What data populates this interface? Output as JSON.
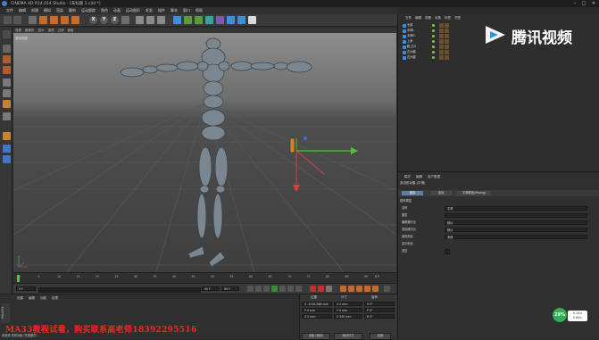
{
  "window": {
    "title": "CINEMA 4D R14.014 Studio - [未标题 1.c4d *]",
    "buttons": [
      "–",
      "□",
      "✕"
    ]
  },
  "menubar": {
    "items": [
      "文件",
      "编辑",
      "创建",
      "模拟",
      "渲染",
      "雕刻",
      "运动跟踪",
      "角色",
      "动画",
      "运动图形",
      "毛发",
      "插件",
      "脚本",
      "窗口",
      "帮助"
    ]
  },
  "toolbar": {
    "axis_x": "X",
    "axis_y": "Y",
    "axis_z": "Z"
  },
  "viewport": {
    "menu": [
      "查看",
      "摄像机",
      "显示",
      "选项",
      "过滤",
      "面板"
    ],
    "label": "透视视图"
  },
  "timeline": {
    "ticks": [
      "0",
      "5",
      "10",
      "15",
      "20",
      "25",
      "30",
      "35",
      "40",
      "45",
      "50",
      "55",
      "60",
      "65",
      "70",
      "75",
      "80",
      "85",
      "90"
    ],
    "current_frame": "0 F",
    "start_frame": "0 F",
    "end_frame": "90 F",
    "end_field": "90 F",
    "frame_readout": "0 F"
  },
  "material_manager": {
    "menu": [
      "创建",
      "编辑",
      "功能",
      "纹理"
    ]
  },
  "coordinates": {
    "headers": [
      "位置",
      "尺寸",
      "旋转"
    ],
    "rows": [
      {
        "pos": "X  -1018.568 mm",
        "size": "X  0 mm",
        "rot": "H  0°"
      },
      {
        "pos": "Y  0 mm",
        "size": "Y  0 mm",
        "rot": "P  0°"
      },
      {
        "pos": "Z  0 mm",
        "size": "Z  300 mm",
        "rot": "B  0°"
      }
    ],
    "mode_object": "对象 (相对)",
    "mode_size": "绝对尺寸",
    "apply_label": "应用"
  },
  "watermark": "MA33教程试看，购买联系高老师18392295516",
  "status": "未选择 任何对象 (在视图中)",
  "maxon_logo": "MAXON",
  "object_manager": {
    "menu": [
      "文件",
      "编辑",
      "查看",
      "对象",
      "标签",
      "书签"
    ],
    "objects": [
      {
        "name": "头部"
      },
      {
        "name": "手臂L"
      },
      {
        "name": "手臂R"
      },
      {
        "name": "上身"
      },
      {
        "name": "腿_右5"
      },
      {
        "name": "左大腿"
      },
      {
        "name": "右大腿"
      }
    ]
  },
  "branding": {
    "name": "腾讯视频"
  },
  "attribute_manager": {
    "menu": [
      "模式",
      "编辑",
      "用户数据"
    ],
    "title": "多边形对象 [平滑]",
    "tabs": [
      "基本",
      "坐标",
      "平滑着色(Phong)"
    ],
    "section": "基本属性",
    "rows": [
      {
        "label": "名称",
        "value": "平滑"
      },
      {
        "label": "图层",
        "value": ""
      },
      {
        "label": "编辑器可见",
        "value": "默认"
      },
      {
        "label": "渲染器可见",
        "value": "默认"
      },
      {
        "label": "使用颜色",
        "value": "关闭"
      },
      {
        "label": "显示颜色",
        "value": ""
      },
      {
        "label": "透显",
        "value": ""
      }
    ]
  },
  "network": {
    "percent": "29%",
    "upload": "0.1K/s",
    "download": "0.6K/s"
  },
  "colors": {
    "accent": "#5c7fa6",
    "axis_x": "#e03c3c",
    "axis_y": "#4fbf3d",
    "axis_z": "#3d6fe0",
    "figure": "#7d8a94",
    "watermark": "#ff2222"
  }
}
